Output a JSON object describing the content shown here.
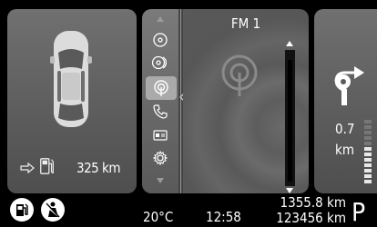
{
  "vehicle": {
    "range": "325 km"
  },
  "menu": {
    "items": [
      {
        "name": "cd-icon"
      },
      {
        "name": "multi-disc-icon"
      },
      {
        "name": "radio-antenna-icon",
        "selected": true
      },
      {
        "name": "phone-icon"
      },
      {
        "name": "card-icon"
      },
      {
        "name": "settings-icon"
      }
    ]
  },
  "media": {
    "station": "FM 1",
    "volume_fraction": 0.96
  },
  "navigation": {
    "distance_value": "0.7",
    "distance_unit": "km",
    "distance_fraction": 0.6
  },
  "status": {
    "temperature": "20°C",
    "time": "12:58",
    "trip": "1355.8 km",
    "odometer": "123456 km",
    "gear": "P"
  }
}
